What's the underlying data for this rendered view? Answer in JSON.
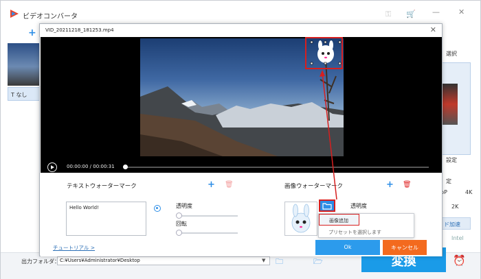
{
  "app": {
    "title": "ビデオコンバータ",
    "none_label": "なし",
    "right_labels": {
      "select": "選択",
      "settings": "設定",
      "set2": "定",
      "bp": "bP",
      "res": "4K",
      "res2": "2K",
      "accel": "ド加速",
      "intel": "Intel"
    },
    "output_folder_label": "出力フォルダ：",
    "output_folder_value": "C:¥Users¥Administrator¥Desktop",
    "convert_label": "変換"
  },
  "dialog": {
    "title": "VID_20211218_181253.mp4",
    "time_current": "00:00:00",
    "time_total": "00:00:31",
    "text_watermark": {
      "title": "テキストウォーターマーク",
      "text_value": "Hello World!",
      "opacity_label": "透明度",
      "rotate_label": "回転"
    },
    "image_watermark": {
      "title": "画像ウォーターマーク",
      "opacity_label": "透明度"
    },
    "menu": {
      "add_image": "画像追加",
      "choose_preset": "プリセットを選択します"
    },
    "tutorial_label": "チュートリアル >",
    "ok_label": "Ok",
    "cancel_label": "キャンセル"
  },
  "colors": {
    "accent": "#2c8de6",
    "cancel": "#f36a1e",
    "highlight": "#d61f1f",
    "convert": "#1a9be8"
  },
  "icons": [
    "app-logo-icon",
    "key-icon",
    "cart-icon",
    "play-icon",
    "plus-icon",
    "trash-icon",
    "radio-icon",
    "folder-icon",
    "alarm-icon"
  ]
}
